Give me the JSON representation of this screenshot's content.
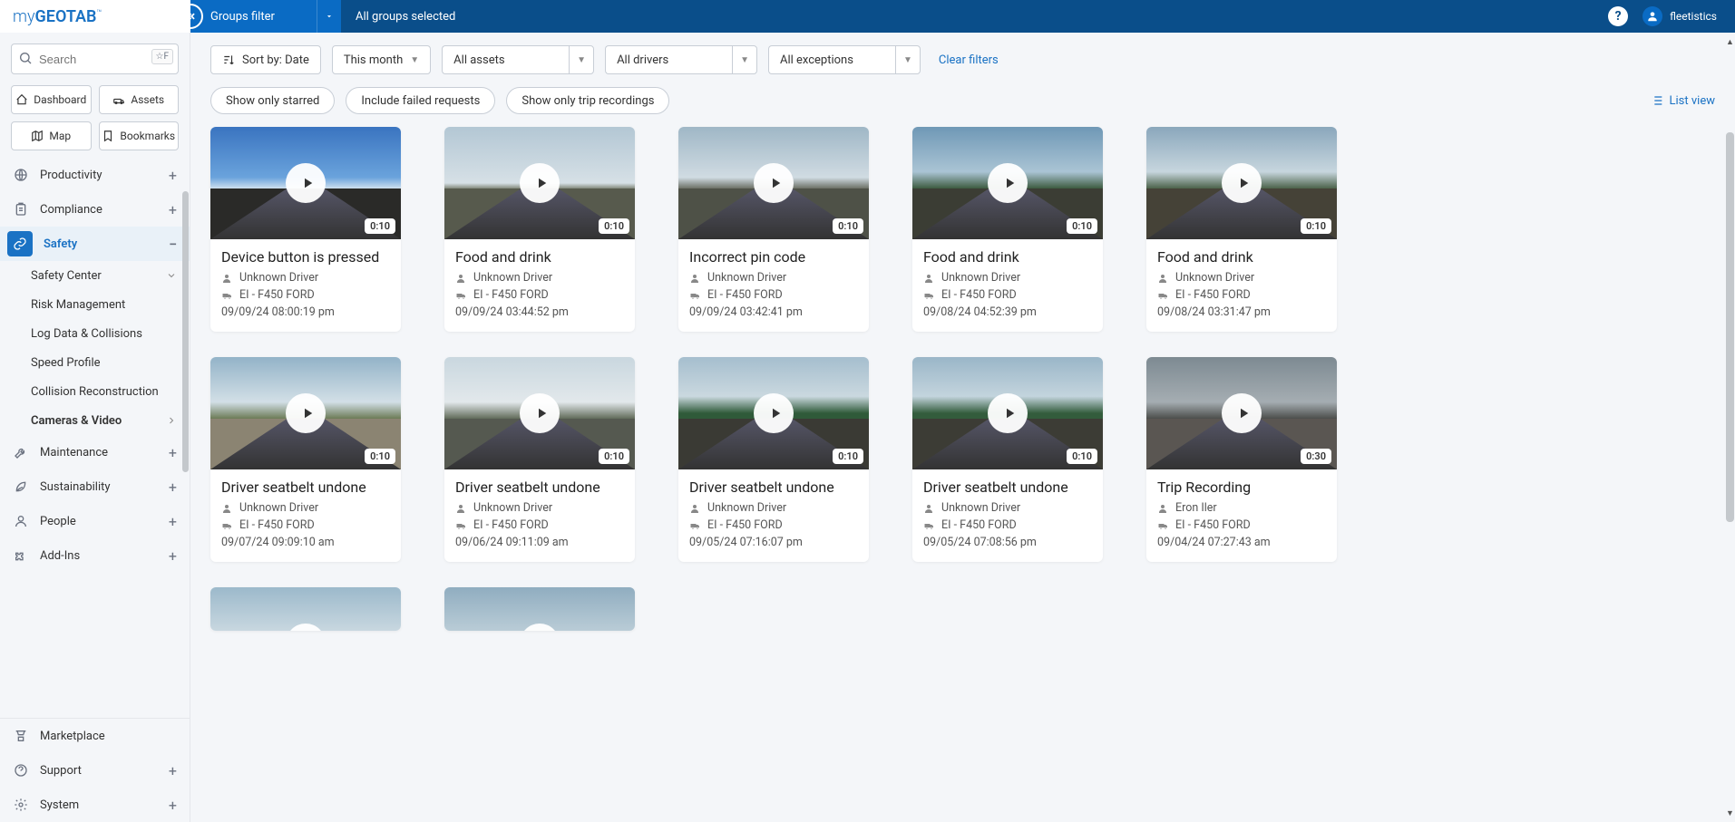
{
  "logo": {
    "thin": "my",
    "bold": "GEOTAB",
    "tm": "™"
  },
  "topbar": {
    "groups_filter": "Groups filter",
    "all_groups": "All groups selected",
    "username": "fleetistics"
  },
  "search": {
    "placeholder": "Search",
    "shortcut": "☆F"
  },
  "quick": {
    "dashboard": "Dashboard",
    "assets": "Assets",
    "map": "Map",
    "bookmarks": "Bookmarks"
  },
  "nav": {
    "productivity": "Productivity",
    "compliance": "Compliance",
    "safety": "Safety",
    "maintenance": "Maintenance",
    "sustainability": "Sustainability",
    "people": "People",
    "addins": "Add-Ins",
    "marketplace": "Marketplace",
    "support": "Support",
    "system": "System",
    "safety_sub": {
      "center": "Safety Center",
      "risk": "Risk Management",
      "log": "Log Data & Collisions",
      "speed": "Speed Profile",
      "collision": "Collision Reconstruction",
      "cameras": "Cameras & Video"
    }
  },
  "toolbar": {
    "sort": "Sort by: Date",
    "period": "This month",
    "assets": "All assets",
    "drivers": "All drivers",
    "exceptions": "All exceptions",
    "clear": "Clear filters"
  },
  "chips": {
    "starred": "Show only starred",
    "failed": "Include failed requests",
    "trip": "Show only trip recordings",
    "list": "List view"
  },
  "cards": [
    {
      "title": "Device button is pressed",
      "driver": "Unknown Driver",
      "vehicle": "EI - F450 FORD",
      "ts": "09/09/24 08:00:19 pm",
      "dur": "0:10",
      "sky": "linear-gradient(to bottom,#3a74c0 0%,#6aa3dc 45%,#cfe0ee 55%,#3a3a3a 55%)",
      "ground": "#2a2a28"
    },
    {
      "title": "Food and drink",
      "driver": "Unknown Driver",
      "vehicle": "EI - F450 FORD",
      "ts": "09/09/24 03:44:52 pm",
      "dur": "0:10",
      "sky": "linear-gradient(to bottom,#b3c7d4 0%,#d6e0e6 50%,#7f8577 55%)",
      "ground": "#575a4d"
    },
    {
      "title": "Incorrect pin code",
      "driver": "Unknown Driver",
      "vehicle": "EI - F450 FORD",
      "ts": "09/09/24 03:42:41 pm",
      "dur": "0:10",
      "sky": "linear-gradient(to bottom,#9fb7c6 0%,#d0dbe2 45%,#6a6e63 55%)",
      "ground": "#4e5147"
    },
    {
      "title": "Food and drink",
      "driver": "Unknown Driver",
      "vehicle": "EI - F450 FORD",
      "ts": "09/08/24 04:52:39 pm",
      "dur": "0:10",
      "sky": "linear-gradient(to bottom,#6f98b6 0%,#aac4d4 40%,#3c5a3e 55%)",
      "ground": "#3b3d34"
    },
    {
      "title": "Food and drink",
      "driver": "Unknown Driver",
      "vehicle": "EI - F450 FORD",
      "ts": "09/08/24 03:31:47 pm",
      "dur": "0:10",
      "sky": "linear-gradient(to bottom,#8aa7bc 0%,#c7d6de 40%,#4a6148 55%)",
      "ground": "#454237"
    },
    {
      "title": "Driver seatbelt undone",
      "driver": "Unknown Driver",
      "vehicle": "EI - F450 FORD",
      "ts": "09/07/24 09:09:10 am",
      "dur": "0:10",
      "sky": "linear-gradient(to bottom,#93b3c8 0%,#d2dfe6 40%,#6b7a55 55%)",
      "ground": "#8b8472"
    },
    {
      "title": "Driver seatbelt undone",
      "driver": "Unknown Driver",
      "vehicle": "EI - F450 FORD",
      "ts": "09/06/24 09:11:09 am",
      "dur": "0:10",
      "sky": "linear-gradient(to bottom,#c9d7df 0%,#e2e8eb 40%,#606a58 55%)",
      "ground": "#555950"
    },
    {
      "title": "Driver seatbelt undone",
      "driver": "Unknown Driver",
      "vehicle": "EI - F450 FORD",
      "ts": "09/05/24 07:16:07 pm",
      "dur": "0:10",
      "sky": "linear-gradient(to bottom,#a5bece 0%,#cad8df 35%,#2f5a39 50%)",
      "ground": "#3a3a34"
    },
    {
      "title": "Driver seatbelt undone",
      "driver": "Unknown Driver",
      "vehicle": "EI - F450 FORD",
      "ts": "09/05/24 07:08:56 pm",
      "dur": "0:10",
      "sky": "linear-gradient(to bottom,#9ab6c8 0%,#c3d4dd 35%,#335c3c 50%)",
      "ground": "#3c3c35"
    },
    {
      "title": "Trip Recording",
      "driver": "Eron Iler",
      "vehicle": "EI - F450 FORD",
      "ts": "09/04/24 07:27:43 am",
      "dur": "0:30",
      "sky": "linear-gradient(to bottom,#7d8a92 0%,#a5adb2 40%,#4b4d4a 55%)",
      "ground": "#5a5652"
    }
  ],
  "partial_cards": [
    {
      "sky": "linear-gradient(to bottom,#9cb9cb 0%,#cfdce3 45%,#4c6a48 55%)"
    },
    {
      "sky": "linear-gradient(to bottom,#90adc0 0%,#c0d1da 45%,#3e5d42 55%)"
    }
  ]
}
